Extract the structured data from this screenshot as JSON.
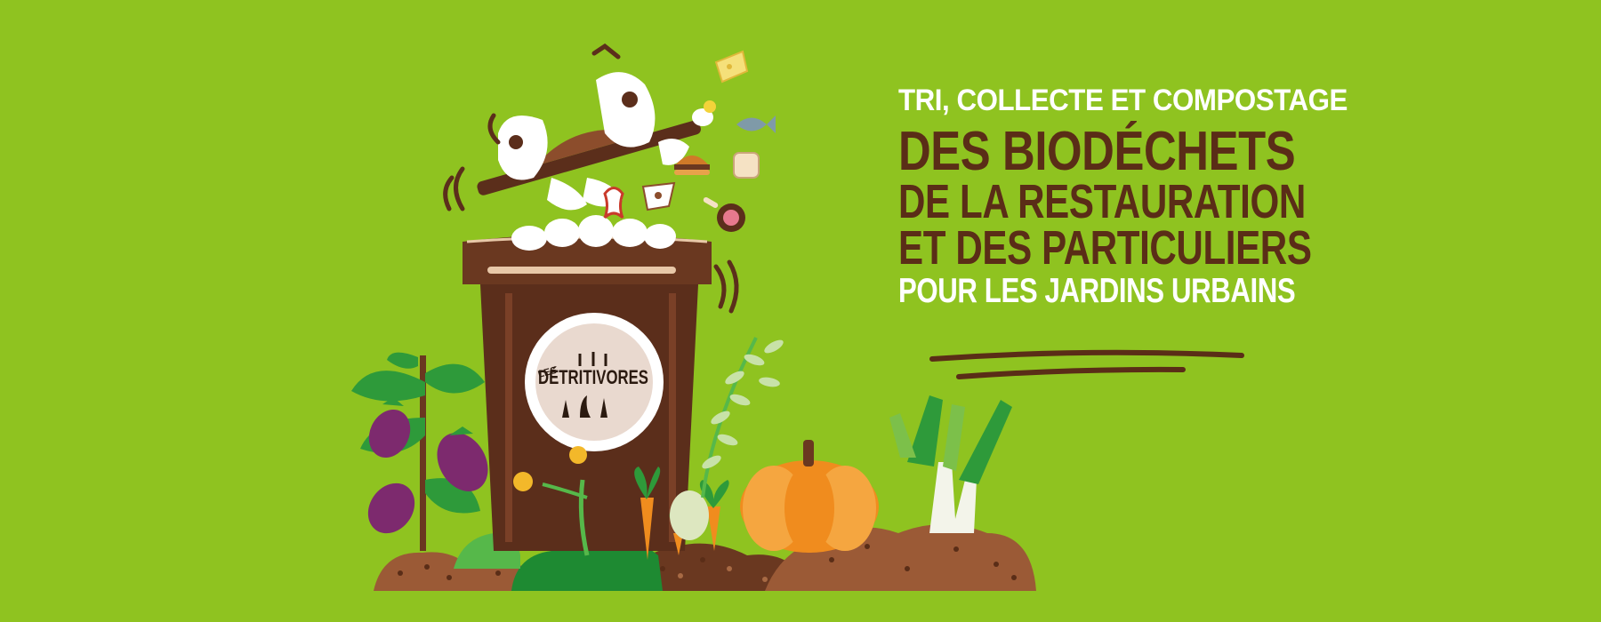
{
  "headline": {
    "line1": "TRI, COLLECTE ET COMPOSTAGE",
    "line2": "DES BIODÉCHETS",
    "line3": "DE LA RESTAURATION",
    "line4": "ET DES PARTICULIERS",
    "line5": "POUR LES JARDINS URBAINS"
  },
  "logo": {
    "prefix": "LES",
    "name": "DÉTRITIVORES"
  },
  "colors": {
    "background": "#8fc320",
    "brown": "#5a2d17",
    "white": "#ffffff",
    "bin": "#5b2e1b",
    "pumpkin": "#f08c1e",
    "eggplant": "#7d2a6e",
    "leaf": "#2e9a3a"
  },
  "icons": [
    "cheese-icon",
    "egg-icon",
    "fish-icon",
    "burger-icon",
    "bread-icon",
    "apple-core-icon",
    "cup-icon",
    "ham-icon"
  ]
}
